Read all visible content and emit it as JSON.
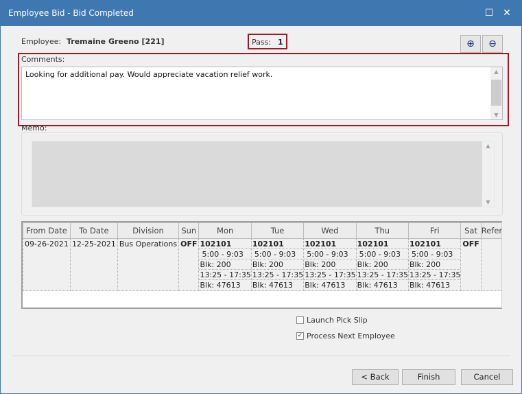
{
  "window": {
    "title": "Employee Bid - Bid Completed",
    "maximize": "☐",
    "close": "✕"
  },
  "employee": {
    "label": "Employee:",
    "value": "Tremaine Greeno [221]"
  },
  "pass": {
    "label": "Pass:",
    "value": "1"
  },
  "comments": {
    "label": "Comments:",
    "value": "Looking for additional pay. Would appreciate vacation relief work."
  },
  "memo": {
    "label": "Memo:",
    "value": ""
  },
  "grid": {
    "columns": [
      "From Date",
      "To Date",
      "Division",
      "Sun",
      "Mon",
      "Tue",
      "Wed",
      "Thu",
      "Fri",
      "Sat",
      "Reference"
    ],
    "rows": [
      {
        "from": "09-26-2021",
        "to": "12-25-2021",
        "division": "Bus Operations",
        "sun": "OFF",
        "sat": "OFF",
        "reference": "",
        "days": [
          {
            "run": "102101",
            "time1": "5:00 -  9:03",
            "blk1": "Blk: 200",
            "time2": "13:25 - 17:35",
            "blk2": "Blk: 47613"
          },
          {
            "run": "102101",
            "time1": "5:00 -  9:03",
            "blk1": "Blk: 200",
            "time2": "13:25 - 17:35",
            "blk2": "Blk: 47613"
          },
          {
            "run": "102101",
            "time1": "5:00 -  9:03",
            "blk1": "Blk: 200",
            "time2": "13:25 - 17:35",
            "blk2": "Blk: 47613"
          },
          {
            "run": "102101",
            "time1": "5:00 -  9:03",
            "blk1": "Blk: 200",
            "time2": "13:25 - 17:35",
            "blk2": "Blk: 47613"
          },
          {
            "run": "102101",
            "time1": "5:00 -  9:03",
            "blk1": "Blk: 200",
            "time2": "13:25 - 17:35",
            "blk2": "Blk: 47613"
          }
        ]
      }
    ]
  },
  "options": {
    "launch_pick_slip": {
      "label": "Launch Pick Slip",
      "checked": false
    },
    "process_next": {
      "label": "Process Next Employee",
      "checked": true
    }
  },
  "buttons": {
    "back": "< Back",
    "finish": "Finish",
    "cancel": "Cancel"
  },
  "colors": {
    "titlebar": "#3f77b1",
    "highlight": "#9b1b24"
  }
}
